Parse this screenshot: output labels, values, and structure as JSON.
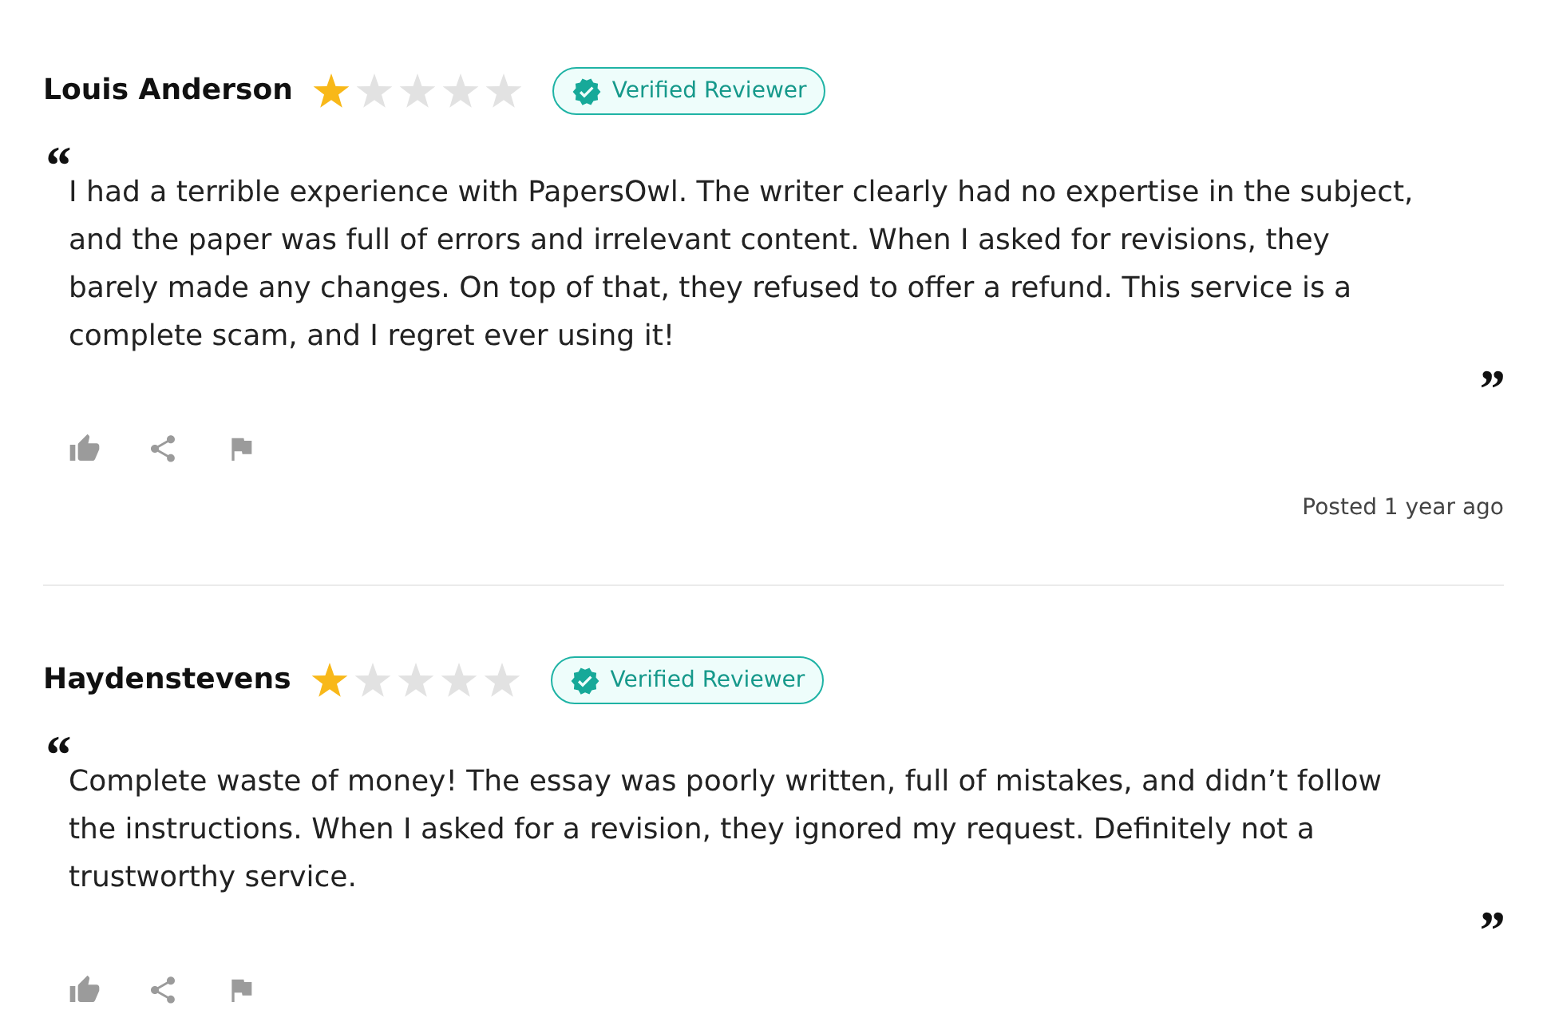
{
  "reviews": [
    {
      "author": "Louis Anderson",
      "stars": 1,
      "badge": "Verified Reviewer",
      "open_quote": "“",
      "text": "I had a terrible experience with PapersOwl. The writer clearly had no expertise in the subject, and the paper was full of errors and irrelevant content. When I asked for revisions, they barely made any changes. On top of that, they refused to offer a refund. This service is a complete scam, and I regret ever using it!",
      "close_quote": "”",
      "posted": "Posted 1 year ago"
    },
    {
      "author": "Haydenstevens",
      "stars": 1,
      "badge": "Verified Reviewer",
      "open_quote": "“",
      "text": "Complete waste of money! The essay was poorly written, full of mistakes, and didn’t follow the instructions. When I asked for a revision, they ignored my request. Definitely not a trustworthy service.",
      "close_quote": "”"
    }
  ]
}
